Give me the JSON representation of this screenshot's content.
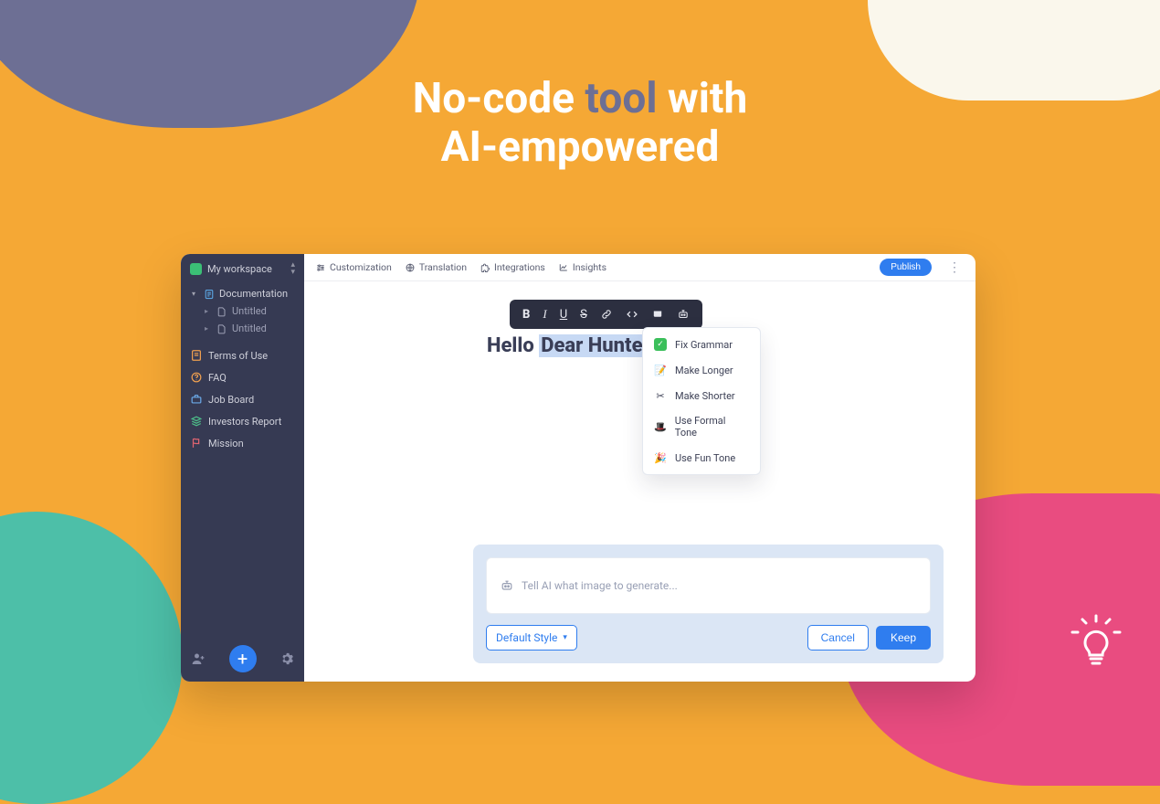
{
  "hero": {
    "line1_a": "No-code ",
    "line1_accent": "tool",
    "line1_b": " with",
    "line2": "AI-empowered"
  },
  "sidebar": {
    "workspace": "My workspace",
    "tree": {
      "root": "Documentation",
      "children": [
        "Untitled",
        "Untitled"
      ]
    },
    "nav": [
      {
        "label": "Terms of Use",
        "color": "c-orange"
      },
      {
        "label": "FAQ",
        "color": "c-orange"
      },
      {
        "label": "Job Board",
        "color": "c-blue"
      },
      {
        "label": "Investors Report",
        "color": "c-green"
      },
      {
        "label": "Mission",
        "color": "c-red"
      }
    ]
  },
  "topbar": {
    "items": [
      "Customization",
      "Translation",
      "Integrations",
      "Insights"
    ],
    "publish": "Publish"
  },
  "toolbar": {
    "bold": "B",
    "italic": "I",
    "underline": "U",
    "strike": "S"
  },
  "document": {
    "heading_prefix": "Hello ",
    "heading_selected": "Dear Hunte"
  },
  "ai_menu": [
    "Fix Grammar",
    "Make Longer",
    "Make Shorter",
    "Use Formal Tone",
    "Use Fun Tone"
  ],
  "ai_panel": {
    "placeholder": "Tell AI what image to generate...",
    "style": "Default Style",
    "cancel": "Cancel",
    "keep": "Keep"
  }
}
